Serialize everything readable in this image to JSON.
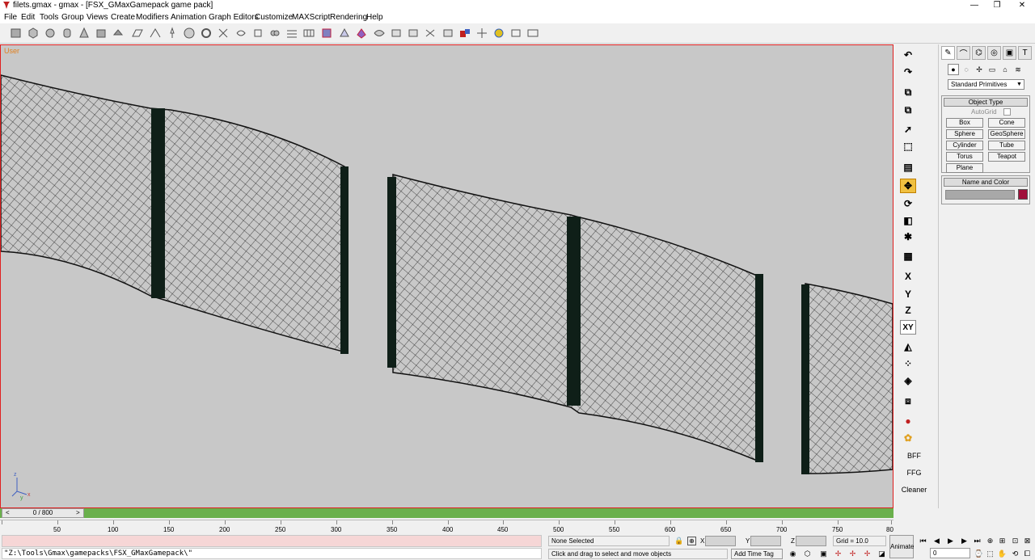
{
  "window": {
    "title": "filets.gmax - gmax - [FSX_GMaxGamepack game pack]",
    "controls": [
      "—",
      "❐",
      "✕"
    ]
  },
  "menu": [
    "File",
    "Edit",
    "Tools",
    "Group",
    "Views",
    "Create",
    "Modifiers",
    "Animation",
    "Graph Editors",
    "Customize",
    "MAXScript",
    "Rendering",
    "Help"
  ],
  "viewport": {
    "label": "User",
    "border_color": "#e02020"
  },
  "viewport_tools": {
    "axis_x": "X",
    "axis_y": "Y",
    "axis_z": "Z",
    "axis_xy": "XY",
    "bff": "BFF",
    "ffg": "FFG",
    "cleaner": "Cleaner"
  },
  "command_panel": {
    "category": "Standard Primitives",
    "object_type": {
      "header": "Object Type",
      "autogrid": "AutoGrid",
      "buttons": [
        "Box",
        "Cone",
        "Sphere",
        "GeoSphere",
        "Cylinder",
        "Tube",
        "Torus",
        "Teapot",
        "Plane"
      ]
    },
    "name_color": {
      "header": "Name and Color",
      "color": "#a0103a"
    }
  },
  "timeline": {
    "slider": "0 / 800",
    "ticks": [
      "50",
      "100",
      "150",
      "200",
      "250",
      "300",
      "350",
      "400",
      "450",
      "500",
      "550",
      "600",
      "650",
      "700",
      "750",
      "80"
    ]
  },
  "status": {
    "maxscript_line": "\"Z:\\Tools\\Gmax\\gamepacks\\FSX_GMaxGamepack\\\"",
    "selection": "None Selected",
    "prompt": "Click and drag to select and move objects",
    "x_label": "X",
    "y_label": "Y",
    "z_label": "Z",
    "grid": "Grid = 10.0",
    "add_time_tag": "Add Time Tag",
    "animate": "Animate",
    "frame": "0"
  }
}
